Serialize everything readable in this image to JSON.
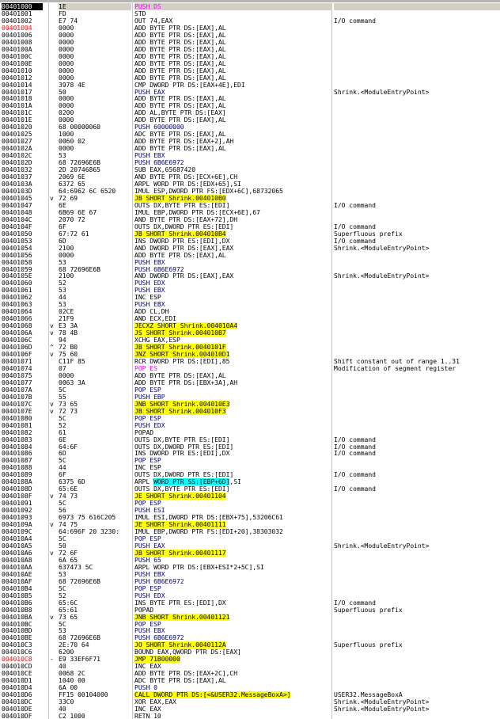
{
  "rows": [
    {
      "a": "00401000",
      "h": "1E",
      "d": "PUSH DS",
      "c": "",
      "cls": "row-first",
      "dcls": "op-nop-seg"
    },
    {
      "a": "00401001",
      "h": "FD",
      "d": "STD",
      "c": ""
    },
    {
      "a": "00401002",
      "h": "E7 74",
      "d": "OUT 74,EAX",
      "c": "I/O command"
    },
    {
      "a": "00401004",
      "h": "0000",
      "d": "ADD BYTE PTR DS:[EAX],AL",
      "c": "",
      "acls": "addr-bp"
    },
    {
      "a": "00401006",
      "h": "0000",
      "d": "ADD BYTE PTR DS:[EAX],AL",
      "c": ""
    },
    {
      "a": "00401008",
      "h": "0000",
      "d": "ADD BYTE PTR DS:[EAX],AL",
      "c": ""
    },
    {
      "a": "0040100A",
      "h": "0000",
      "d": "ADD BYTE PTR DS:[EAX],AL",
      "c": ""
    },
    {
      "a": "0040100C",
      "h": "0000",
      "d": "ADD BYTE PTR DS:[EAX],AL",
      "c": ""
    },
    {
      "a": "0040100E",
      "h": "0000",
      "d": "ADD BYTE PTR DS:[EAX],AL",
      "c": ""
    },
    {
      "a": "00401010",
      "h": "0000",
      "d": "ADD BYTE PTR DS:[EAX],AL",
      "c": ""
    },
    {
      "a": "00401012",
      "h": "0000",
      "d": "ADD BYTE PTR DS:[EAX],AL",
      "c": ""
    },
    {
      "a": "00401014",
      "h": "3978 4E",
      "d": "CMP DWORD PTR DS:[EAX+4E],EDI",
      "c": ""
    },
    {
      "a": "00401017",
      "h": "50",
      "d": "PUSH EAX",
      "c": "Shrink.<ModuleEntryPoint>",
      "dcls": "dis-navy"
    },
    {
      "a": "00401018",
      "h": "0000",
      "d": "ADD BYTE PTR DS:[EAX],AL",
      "c": ""
    },
    {
      "a": "0040101A",
      "h": "0000",
      "d": "ADD BYTE PTR DS:[EAX],AL",
      "c": ""
    },
    {
      "a": "0040101C",
      "h": "0200",
      "d": "ADD AL,BYTE PTR DS:[EAX]",
      "c": ""
    },
    {
      "a": "0040101E",
      "h": "0000",
      "d": "ADD BYTE PTR DS:[EAX],AL",
      "c": ""
    },
    {
      "a": "00401020",
      "h": "68 00000060",
      "d": "PUSH 60000000",
      "c": "",
      "dcls": "dis-navy"
    },
    {
      "a": "00401025",
      "h": "1000",
      "d": "ADC BYTE PTR DS:[EAX],AL",
      "c": ""
    },
    {
      "a": "00401027",
      "h": "0060 02",
      "d": "ADD BYTE PTR DS:[EAX+2],AH",
      "c": ""
    },
    {
      "a": "0040102A",
      "h": "0000",
      "d": "ADD BYTE PTR DS:[EAX],AL",
      "c": ""
    },
    {
      "a": "0040102C",
      "h": "53",
      "d": "PUSH EBX",
      "c": "",
      "dcls": "dis-navy"
    },
    {
      "a": "0040102D",
      "h": "68 72696E6B",
      "d": "PUSH 6B6E6972",
      "c": "",
      "dcls": "dis-navy"
    },
    {
      "a": "00401032",
      "h": "2D 20746865",
      "d": "SUB EAX,65687420",
      "c": ""
    },
    {
      "a": "00401037",
      "h": "2069 6E",
      "d": "AND BYTE PTR DS:[ECX+6E],CH",
      "c": ""
    },
    {
      "a": "0040103A",
      "h": "6372 65",
      "d": "ARPL WORD PTR DS:[EDX+65],SI",
      "c": ""
    },
    {
      "a": "0040103D",
      "h": "64:6962 6C 6520",
      "d": "IMUL ESP,DWORD PTR FS:[EDX+6C],68732065",
      "c": ""
    },
    {
      "a": "00401045",
      "g": "v",
      "h": "72 69",
      "d": "JB SHORT Shrink.004010B0",
      "c": "",
      "dcls": "jump"
    },
    {
      "a": "00401047",
      "h": "6E",
      "d": "OUTS DX,BYTE PTR ES:[EDI]",
      "c": "I/O command"
    },
    {
      "a": "00401048",
      "h": "6B69 6E 67",
      "d": "IMUL EBP,DWORD PTR DS:[ECX+6E],67",
      "c": ""
    },
    {
      "a": "0040104C",
      "h": "2070 72",
      "d": "AND BYTE PTR DS:[EAX+72],DH",
      "c": ""
    },
    {
      "a": "0040104F",
      "h": "6F",
      "d": "OUTS DX,DWORD PTR ES:[EDI]",
      "c": "I/O command"
    },
    {
      "a": "00401050",
      "h": "67:72 61",
      "d": "JB SHORT Shrink.004010B4",
      "c": "Superfluous prefix",
      "dcls": "jump"
    },
    {
      "a": "00401053",
      "h": "6D",
      "d": "INS DWORD PTR ES:[EDI],DX",
      "c": "I/O command"
    },
    {
      "a": "00401054",
      "h": "2100",
      "d": "AND DWORD PTR DS:[EAX],EAX",
      "c": "Shrink.<ModuleEntryPoint>"
    },
    {
      "a": "00401056",
      "h": "0000",
      "d": "ADD BYTE PTR DS:[EAX],AL",
      "c": ""
    },
    {
      "a": "00401058",
      "h": "53",
      "d": "PUSH EBX",
      "c": "",
      "dcls": "dis-navy"
    },
    {
      "a": "00401059",
      "h": "68 72696E6B",
      "d": "PUSH 6B6E6972",
      "c": "",
      "dcls": "dis-navy"
    },
    {
      "a": "0040105E",
      "h": "2100",
      "d": "AND DWORD PTR DS:[EAX],EAX",
      "c": "Shrink.<ModuleEntryPoint>"
    },
    {
      "a": "00401060",
      "h": "52",
      "d": "PUSH EDX",
      "c": "",
      "dcls": "dis-navy"
    },
    {
      "a": "00401061",
      "h": "53",
      "d": "PUSH EBX",
      "c": "",
      "dcls": "dis-navy"
    },
    {
      "a": "00401062",
      "h": "44",
      "d": "INC ESP",
      "c": ""
    },
    {
      "a": "00401063",
      "h": "53",
      "d": "PUSH EBX",
      "c": "",
      "dcls": "dis-navy"
    },
    {
      "a": "00401064",
      "h": "02CE",
      "d": "ADD CL,DH",
      "c": ""
    },
    {
      "a": "00401066",
      "h": "21F9",
      "d": "AND ECX,EDI",
      "c": ""
    },
    {
      "a": "00401068",
      "g": "v",
      "h": "E3 3A",
      "d": "JECXZ SHORT Shrink.004010A4",
      "c": "",
      "dcls": "jump"
    },
    {
      "a": "0040106A",
      "g": "v",
      "h": "78 4B",
      "d": "JS SHORT Shrink.004010B7",
      "c": "",
      "dcls": "jump"
    },
    {
      "a": "0040106C",
      "h": "94",
      "d": "XCHG EAX,ESP",
      "c": ""
    },
    {
      "a": "0040106D",
      "g": "^",
      "h": "72 B0",
      "d": "JB SHORT Shrink.0040101F",
      "c": "",
      "dcls": "jump"
    },
    {
      "a": "0040106F",
      "g": "v",
      "h": "75 60",
      "d": "JNZ SHORT Shrink.004010D1",
      "c": "",
      "dcls": "jump"
    },
    {
      "a": "00401071",
      "h": "C11F 85",
      "d": "RCR DWORD PTR DS:[EDI],85",
      "c": "Shift constant out of range 1..31"
    },
    {
      "a": "00401074",
      "h": "07",
      "d": "POP ES",
      "c": "Modification of segment register",
      "dcls": "op-nop-seg"
    },
    {
      "a": "00401075",
      "h": "0000",
      "d": "ADD BYTE PTR DS:[EAX],AL",
      "c": ""
    },
    {
      "a": "00401077",
      "h": "0063 3A",
      "d": "ADD BYTE PTR DS:[EBX+3A],AH",
      "c": ""
    },
    {
      "a": "0040107A",
      "h": "5C",
      "d": "POP ESP",
      "c": "",
      "dcls": "dis-navy"
    },
    {
      "a": "0040107B",
      "h": "55",
      "d": "PUSH EBP",
      "c": "",
      "dcls": "dis-navy"
    },
    {
      "a": "0040107C",
      "g": "v",
      "h": "73 65",
      "d": "JNB SHORT Shrink.004010E3",
      "c": "",
      "dcls": "jump"
    },
    {
      "a": "0040107E",
      "g": "v",
      "h": "72 73",
      "d": "JB SHORT Shrink.004010F3",
      "c": "",
      "dcls": "jump"
    },
    {
      "a": "00401080",
      "h": "5C",
      "d": "POP ESP",
      "c": "",
      "dcls": "dis-navy"
    },
    {
      "a": "00401081",
      "h": "52",
      "d": "PUSH EDX",
      "c": "",
      "dcls": "dis-navy"
    },
    {
      "a": "00401082",
      "h": "61",
      "d": "POPAD",
      "c": ""
    },
    {
      "a": "00401083",
      "h": "6E",
      "d": "OUTS DX,BYTE PTR ES:[EDI]",
      "c": "I/O command"
    },
    {
      "a": "00401084",
      "h": "64:6F",
      "d": "OUTS DX,DWORD PTR ES:[EDI]",
      "c": "I/O command"
    },
    {
      "a": "00401086",
      "h": "6D",
      "d": "INS DWORD PTR ES:[EDI],DX",
      "c": "I/O command"
    },
    {
      "a": "00401087",
      "h": "5C",
      "d": "POP ESP",
      "c": "",
      "dcls": "dis-navy"
    },
    {
      "a": "00401088",
      "h": "44",
      "d": "INC ESP",
      "c": ""
    },
    {
      "a": "00401089",
      "h": "6F",
      "d": "OUTS DX,DWORD PTR ES:[EDI]",
      "c": "I/O command"
    },
    {
      "a": "0040108A",
      "h": "6375 6D",
      "d": "ARPL WORD PTR SS:[EBP+6D],SI",
      "c": "",
      "mem": "WORD PTR SS:[EBP+6D]"
    },
    {
      "a": "0040108D",
      "h": "65:6E",
      "d": "OUTS DX,BYTE PTR ES:[EDI]",
      "c": "I/O command"
    },
    {
      "a": "0040108F",
      "g": "v",
      "h": "74 73",
      "d": "JE SHORT Shrink.00401104",
      "c": "",
      "dcls": "jump"
    },
    {
      "a": "00401091",
      "h": "5C",
      "d": "POP ESP",
      "c": "",
      "dcls": "dis-navy"
    },
    {
      "a": "00401092",
      "h": "56",
      "d": "PUSH ESI",
      "c": "",
      "dcls": "dis-navy"
    },
    {
      "a": "00401093",
      "h": "6973 75 616C205",
      "d": "IMUL ESI,DWORD PTR DS:[EBX+75],53206C61",
      "c": ""
    },
    {
      "a": "0040109A",
      "g": "v",
      "h": "74 75",
      "d": "JE SHORT Shrink.00401111",
      "c": "",
      "dcls": "jump"
    },
    {
      "a": "0040109C",
      "h": "64:696F 20 3230:",
      "d": "IMUL EBP,DWORD PTR FS:[EDI+20],38303032",
      "c": ""
    },
    {
      "a": "004010A4",
      "h": "5C",
      "d": "POP ESP",
      "c": "",
      "dcls": "dis-navy"
    },
    {
      "a": "004010A5",
      "h": "50",
      "d": "PUSH EAX",
      "c": "Shrink.<ModuleEntryPoint>",
      "dcls": "dis-navy"
    },
    {
      "a": "004010A6",
      "g": "v",
      "h": "72 6F",
      "d": "JB SHORT Shrink.00401117",
      "c": "",
      "dcls": "jump"
    },
    {
      "a": "004010A8",
      "h": "6A 65",
      "d": "PUSH 65",
      "c": "",
      "dcls": "dis-navy"
    },
    {
      "a": "004010AA",
      "h": "637473 5C",
      "d": "ARPL WORD PTR DS:[EBX+ESI*2+5C],SI",
      "c": ""
    },
    {
      "a": "004010AE",
      "h": "53",
      "d": "PUSH EBX",
      "c": "",
      "dcls": "dis-navy"
    },
    {
      "a": "004010AF",
      "h": "68 72696E6B",
      "d": "PUSH 6B6E6972",
      "c": "",
      "dcls": "dis-navy"
    },
    {
      "a": "004010B4",
      "h": "5C",
      "d": "POP ESP",
      "c": "",
      "dcls": "dis-navy"
    },
    {
      "a": "004010B5",
      "h": "52",
      "d": "PUSH EDX",
      "c": "",
      "dcls": "dis-navy"
    },
    {
      "a": "004010B6",
      "h": "65:6C",
      "d": "INS BYTE PTR ES:[EDI],DX",
      "c": "I/O command"
    },
    {
      "a": "004010B8",
      "h": "65:61",
      "d": "POPAD",
      "c": "Superfluous prefix"
    },
    {
      "a": "004010BA",
      "g": "v",
      "h": "73 65",
      "d": "JNB SHORT Shrink.00401121",
      "c": "",
      "dcls": "jump"
    },
    {
      "a": "004010BC",
      "h": "5C",
      "d": "POP ESP",
      "c": "",
      "dcls": "dis-navy"
    },
    {
      "a": "004010BD",
      "h": "53",
      "d": "PUSH EBX",
      "c": "",
      "dcls": "dis-navy"
    },
    {
      "a": "004010BE",
      "h": "68 72696E6B",
      "d": "PUSH 6B6E6972",
      "c": "",
      "dcls": "dis-navy"
    },
    {
      "a": "004010C3",
      "h": "2E:70 64",
      "d": "JO SHORT Shrink.0040112A",
      "c": "Superfluous prefix",
      "dcls": "jump"
    },
    {
      "a": "004010C6",
      "h": "6200",
      "d": "BOUND EAX,QWORD PTR DS:[EAX]",
      "c": ""
    },
    {
      "a": "004010C8",
      "g": "-",
      "h": "E9 33EF6F71",
      "d": "JMP 71B00000",
      "c": "",
      "dcls": "jump",
      "acls": "addr-bp"
    },
    {
      "a": "004010CD",
      "h": "40",
      "d": "INC EAX",
      "c": ""
    },
    {
      "a": "004010CE",
      "h": "0068 2C",
      "d": "ADD BYTE PTR DS:[EAX+2C],CH",
      "c": ""
    },
    {
      "a": "004010D1",
      "h": "1040 00",
      "d": "ADC BYTE PTR DS:[EAX],AL",
      "c": ""
    },
    {
      "a": "004010D4",
      "h": "6A 00",
      "d": "PUSH 0",
      "c": "",
      "dcls": "dis-navy"
    },
    {
      "a": "004010D6",
      "h": "FF15 00104000",
      "d": "CALL DWORD PTR DS:[<&USER32.MessageBoxA>]",
      "c": "USER32.MessageBoxA",
      "dcls": "jump"
    },
    {
      "a": "004010DC",
      "h": "33C0",
      "d": "XOR EAX,EAX",
      "c": "Shrink.<ModuleEntryPoint>"
    },
    {
      "a": "004010DE",
      "h": "40",
      "d": "INC EAX",
      "c": "Shrink.<ModuleEntryPoint>"
    },
    {
      "a": "004010DF",
      "h": "C2 1000",
      "d": "RETN 10",
      "c": ""
    }
  ]
}
